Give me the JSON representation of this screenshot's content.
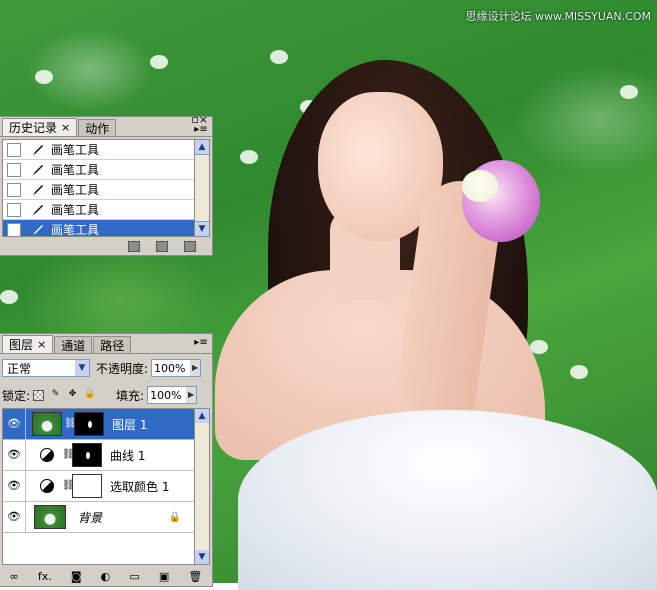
{
  "watermark": "思缘设计论坛 www.MISSYUAN.COM",
  "history_panel": {
    "tabs": [
      {
        "label": "历史记录",
        "active": true
      },
      {
        "label": "动作",
        "active": false
      }
    ],
    "items": [
      {
        "label": "画笔工具",
        "selected": false
      },
      {
        "label": "画笔工具",
        "selected": false
      },
      {
        "label": "画笔工具",
        "selected": false
      },
      {
        "label": "画笔工具",
        "selected": false
      },
      {
        "label": "画笔工具",
        "selected": true
      }
    ]
  },
  "layers_panel": {
    "tabs": [
      {
        "label": "图层",
        "active": true
      },
      {
        "label": "通道",
        "active": false
      },
      {
        "label": "路径",
        "active": false
      }
    ],
    "blend_mode": "正常",
    "opacity_label": "不透明度:",
    "opacity_value": "100%",
    "lock_label": "锁定:",
    "fill_label": "填充:",
    "fill_value": "100%",
    "layers": [
      {
        "name": "图层 1",
        "selected": true,
        "type": "pixel"
      },
      {
        "name": "曲线 1",
        "selected": false,
        "type": "adjustment"
      },
      {
        "name": "选取颜色 1",
        "selected": false,
        "type": "adjustment"
      },
      {
        "name": "背景",
        "selected": false,
        "type": "background"
      }
    ],
    "footer_icons": [
      "link-icon",
      "fx-icon",
      "mask-icon",
      "adjustment-icon",
      "group-icon",
      "new-layer-icon",
      "trash-icon"
    ],
    "footer_fx_label": "fx."
  }
}
